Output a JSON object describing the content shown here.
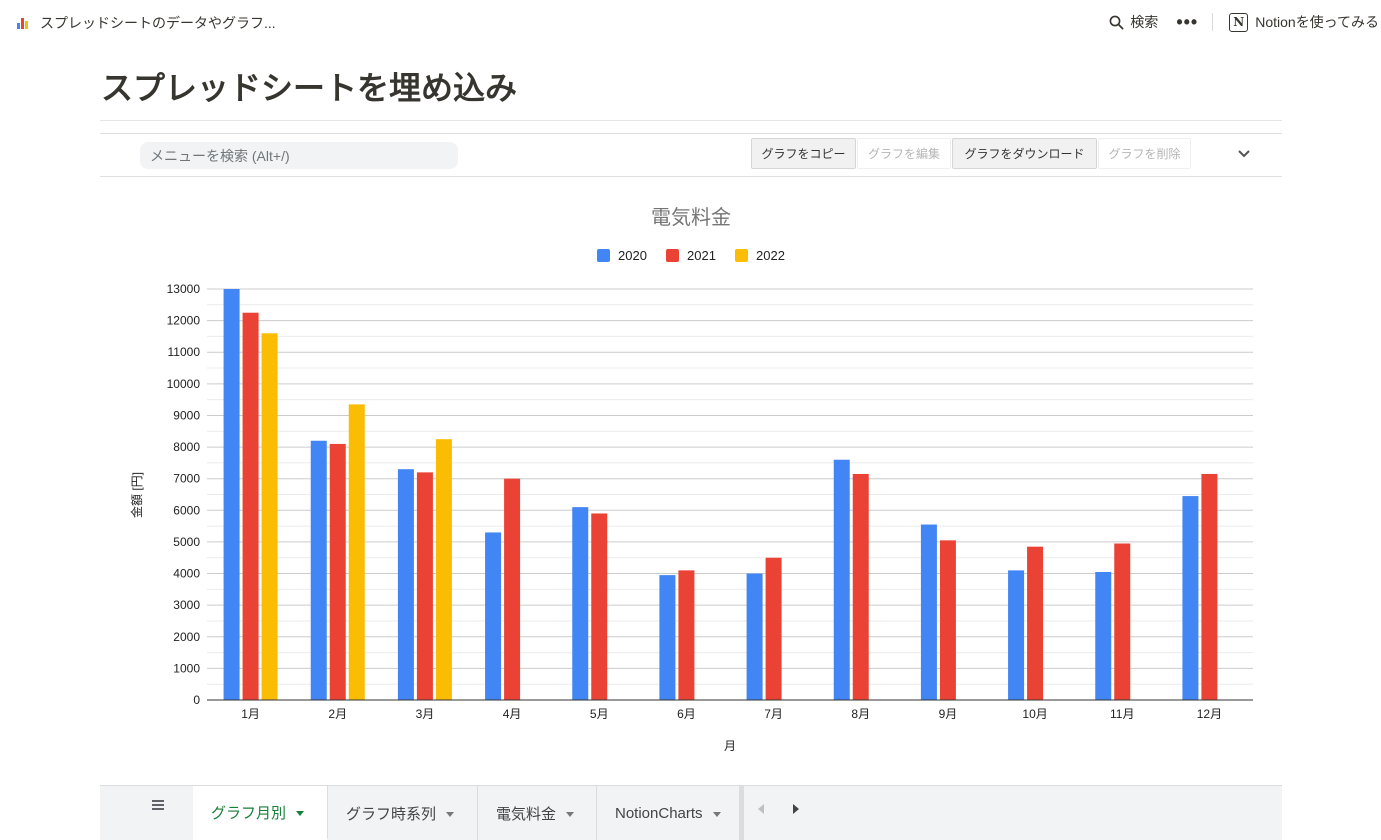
{
  "breadcrumb": {
    "title": "スプレッドシートのデータやグラフ...",
    "icon": "spreadsheet-chart-icon"
  },
  "topbar": {
    "search_label": "検索",
    "more_label": "•••",
    "notion_logo": "N",
    "notion_label": "Notionを使ってみる"
  },
  "page": {
    "title": "スプレッドシートを埋め込み"
  },
  "toolbar": {
    "search_placeholder": "メニューを検索 (Alt+/)",
    "copy_chart": "グラフをコピー",
    "edit_chart": "グラフを編集",
    "download_chart": "グラフをダウンロード",
    "delete_chart": "グラフを削除"
  },
  "chart_data": {
    "type": "bar",
    "title": "電気料金",
    "xlabel": "月",
    "ylabel": "金額 [円]",
    "ylim": [
      0,
      13000
    ],
    "yticks": [
      "0",
      "1000",
      "2000",
      "3000",
      "4000",
      "5000",
      "6000",
      "7000",
      "8000",
      "9000",
      "10000",
      "11000",
      "12000",
      "13000"
    ],
    "categories": [
      "1月",
      "2月",
      "3月",
      "4月",
      "5月",
      "6月",
      "7月",
      "8月",
      "9月",
      "10月",
      "11月",
      "12月"
    ],
    "legend_position": "top",
    "grid": true,
    "series": [
      {
        "name": "2020",
        "color": "#4285f4",
        "values": [
          13000,
          8200,
          7300,
          5300,
          6100,
          3950,
          4000,
          7600,
          5550,
          4100,
          4050,
          6450
        ]
      },
      {
        "name": "2021",
        "color": "#ea4335",
        "values": [
          12250,
          8100,
          7200,
          7000,
          5900,
          4100,
          4500,
          7150,
          5050,
          4850,
          4950,
          7150
        ]
      },
      {
        "name": "2022",
        "color": "#fbbc04",
        "values": [
          11600,
          9350,
          8250,
          null,
          null,
          null,
          null,
          null,
          null,
          null,
          null,
          null
        ]
      }
    ]
  },
  "tabs": [
    {
      "label": "グラフ月別",
      "active": true
    },
    {
      "label": "グラフ時系列",
      "active": false
    },
    {
      "label": "電気料金",
      "active": false
    },
    {
      "label": "NotionCharts",
      "active": false
    }
  ]
}
